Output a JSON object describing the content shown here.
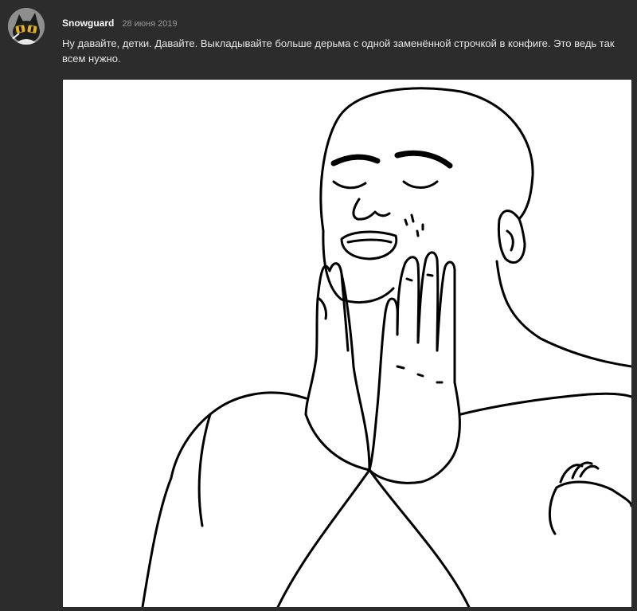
{
  "comment": {
    "author": "Snowguard",
    "date": "28 июня 2019",
    "text": "Ну давайте, детки. Давайте. Выкладывайте больше дерьма с одной заменённой строчкой в конфиге. Это ведь так всем нужно.",
    "avatar_icon": "cat-avatar-icon",
    "attachment_icon": "feels-good-meme-drawing",
    "colors": {
      "background": "#2c2c2c",
      "author": "#ffffff",
      "date": "#9a9a9a",
      "text": "#e6e6e6"
    }
  }
}
